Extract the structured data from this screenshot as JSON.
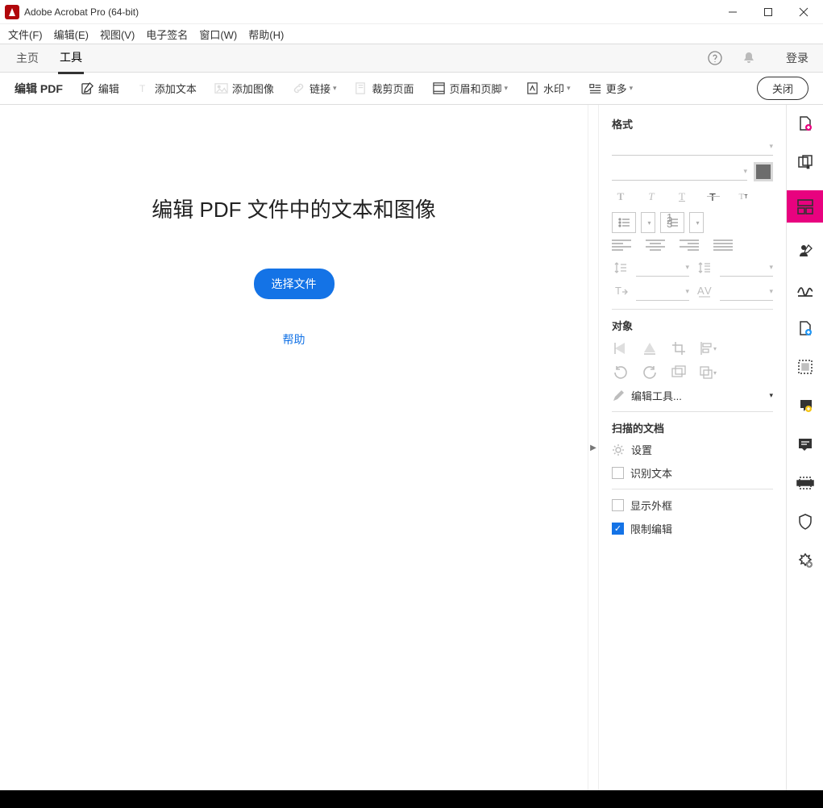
{
  "title": "Adobe Acrobat Pro (64-bit)",
  "menu": [
    "文件(F)",
    "编辑(E)",
    "视图(V)",
    "电子签名",
    "窗口(W)",
    "帮助(H)"
  ],
  "tabs": {
    "home": "主页",
    "tools": "工具",
    "login": "登录"
  },
  "toolbar": {
    "title": "编辑 PDF",
    "edit": "编辑",
    "addtext": "添加文本",
    "addimage": "添加图像",
    "link": "链接",
    "crop": "裁剪页面",
    "header": "页眉和页脚",
    "watermark": "水印",
    "more": "更多",
    "close": "关闭"
  },
  "main": {
    "heading": "编辑 PDF 文件中的文本和图像",
    "pick": "选择文件",
    "help": "帮助"
  },
  "panel": {
    "format": "格式",
    "object": "对象",
    "edittool": "编辑工具...",
    "scanned": "扫描的文档",
    "settings": "设置",
    "ocr": "识别文本",
    "outline": "显示外框",
    "restrict": "限制编辑"
  }
}
